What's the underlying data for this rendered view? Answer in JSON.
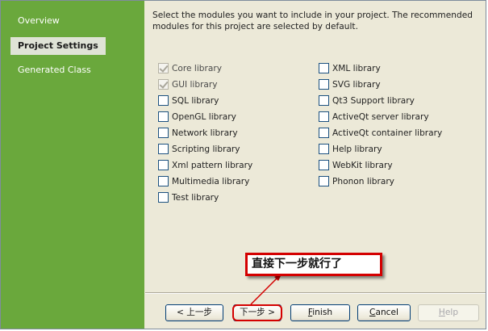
{
  "sidebar": {
    "items": [
      {
        "label": "Overview",
        "active": false
      },
      {
        "label": "Project Settings",
        "active": true
      },
      {
        "label": "Generated Class",
        "active": false
      }
    ]
  },
  "main": {
    "description": "Select the modules you want to include in your project. The recommended modules for this project are selected by default.",
    "modules_left": [
      {
        "label": "Core library",
        "checked": true,
        "disabled": true
      },
      {
        "label": "GUI library",
        "checked": true,
        "disabled": true
      },
      {
        "label": "SQL library",
        "checked": false,
        "disabled": false
      },
      {
        "label": "OpenGL library",
        "checked": false,
        "disabled": false
      },
      {
        "label": "Network library",
        "checked": false,
        "disabled": false
      },
      {
        "label": "Scripting library",
        "checked": false,
        "disabled": false
      },
      {
        "label": "Xml pattern library",
        "checked": false,
        "disabled": false
      },
      {
        "label": "Multimedia library",
        "checked": false,
        "disabled": false
      },
      {
        "label": "Test library",
        "checked": false,
        "disabled": false
      }
    ],
    "modules_right": [
      {
        "label": "XML library",
        "checked": false,
        "disabled": false
      },
      {
        "label": "SVG library",
        "checked": false,
        "disabled": false
      },
      {
        "label": "Qt3 Support library",
        "checked": false,
        "disabled": false
      },
      {
        "label": "ActiveQt server library",
        "checked": false,
        "disabled": false
      },
      {
        "label": "ActiveQt container library",
        "checked": false,
        "disabled": false
      },
      {
        "label": "Help library",
        "checked": false,
        "disabled": false
      },
      {
        "label": "WebKit library",
        "checked": false,
        "disabled": false
      },
      {
        "label": "Phonon library",
        "checked": false,
        "disabled": false
      }
    ]
  },
  "annotation": {
    "text": "直接下一步就行了",
    "color": "#d40000"
  },
  "buttons": {
    "back": "< 上一步",
    "next": "下一步 >",
    "finish_mnemonic": "F",
    "finish_rest": "inish",
    "cancel_mnemonic": "C",
    "cancel_rest": "ancel",
    "help_mnemonic": "H",
    "help_rest": "elp"
  },
  "colors": {
    "sidebar": "#6aa83c",
    "panel": "#ece9d8",
    "annotation": "#d40000"
  }
}
